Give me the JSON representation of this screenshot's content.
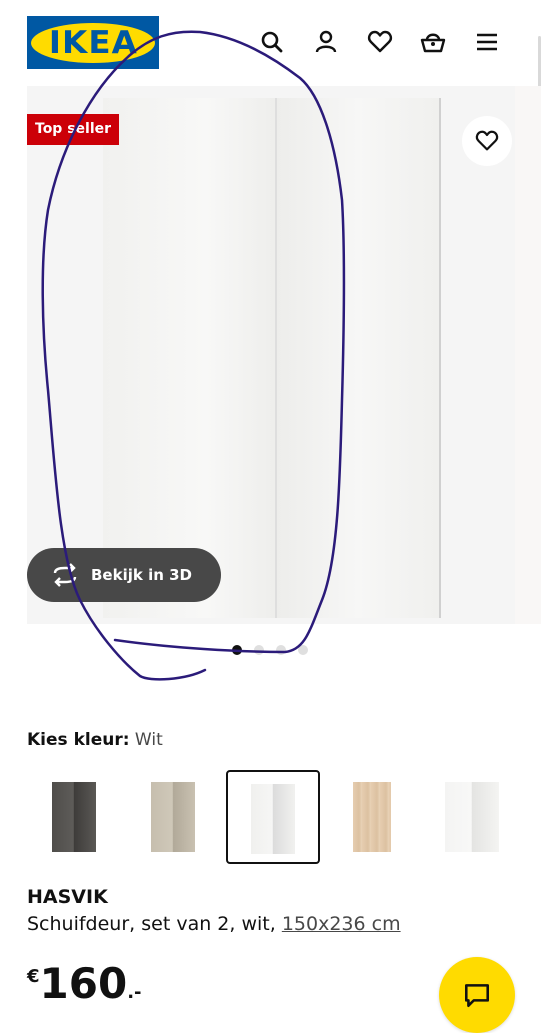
{
  "header": {
    "logo_text": "IKEA",
    "icons": [
      "search-icon",
      "account-icon",
      "favorites-icon",
      "cart-icon",
      "menu-icon"
    ]
  },
  "gallery": {
    "badge": "Top seller",
    "view_3d_label": "Bekijk in 3D",
    "image_count": 4,
    "active_image": 1
  },
  "colors": {
    "label": "Kies kleur:",
    "selected_value": "Wit",
    "swatches": [
      "dark-grey",
      "beige",
      "white",
      "white-stained-oak",
      "white"
    ]
  },
  "product": {
    "name": "HASVIK",
    "description": "Schuifdeur, set van 2, wit, ",
    "size_link": "150x236 cm",
    "price_currency": "€",
    "price_integer": "160",
    "price_decimal": ".-"
  },
  "theme": {
    "ikea_blue": "#0058a3",
    "ikea_yellow": "#ffdb00",
    "badge_red": "#cc0008",
    "annotation_stroke": "#2b1b7a"
  }
}
